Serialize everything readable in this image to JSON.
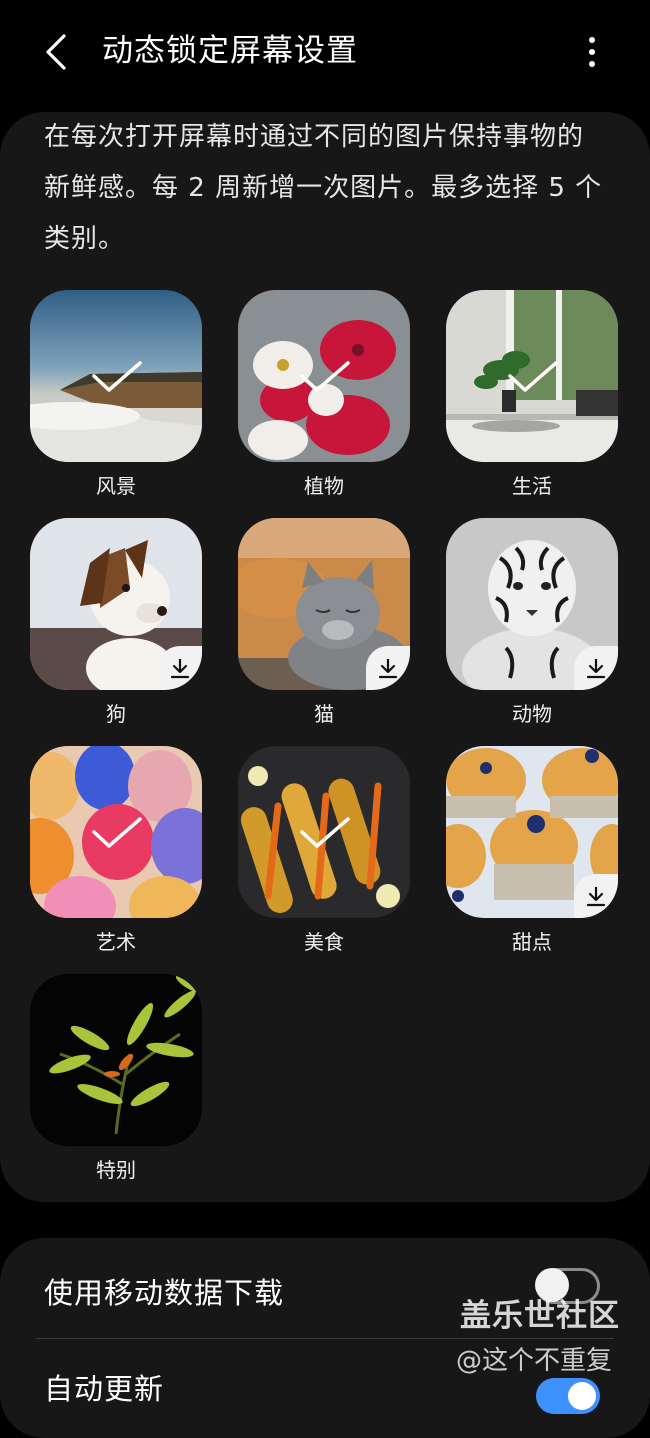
{
  "header": {
    "back_icon": "chevron-left-icon",
    "title": "动态锁定屏幕设置",
    "more_icon": "more-vertical-icon"
  },
  "description": {
    "line1": "在每次打开屏幕时通过不同的图片保持事物的",
    "line2": "新鲜感。每 2 周新增一次图片。最多选择 5 个",
    "line3": "类别。"
  },
  "categories": [
    {
      "label": "风景",
      "selected": true,
      "download": false
    },
    {
      "label": "植物",
      "selected": true,
      "download": false
    },
    {
      "label": "生活",
      "selected": true,
      "download": false
    },
    {
      "label": "狗",
      "selected": false,
      "download": true
    },
    {
      "label": "猫",
      "selected": false,
      "download": true
    },
    {
      "label": "动物",
      "selected": false,
      "download": true
    },
    {
      "label": "艺术",
      "selected": true,
      "download": false
    },
    {
      "label": "美食",
      "selected": true,
      "download": false
    },
    {
      "label": "甜点",
      "selected": false,
      "download": true
    },
    {
      "label": "特别",
      "selected": false,
      "download": false
    }
  ],
  "settings": {
    "mobile_data": {
      "label": "使用移动数据下载",
      "enabled": false
    },
    "auto_update": {
      "label": "自动更新",
      "enabled": true
    }
  },
  "watermark": {
    "line1": "盖乐世社区",
    "line2": "@这个不重复"
  },
  "colors": {
    "background": "#000000",
    "card": "#171717",
    "toggle_on": "#3e91ff"
  }
}
